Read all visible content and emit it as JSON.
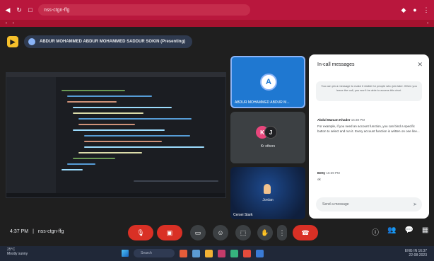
{
  "meeting": {
    "code": "nss-ctgn-ffg",
    "time": "4:37 PM",
    "presenter_pill": "ABDUR MOHAMMED ABDUR MOHAMMED SADDUR SOKIN (Presenting)"
  },
  "participants": [
    {
      "initial": "A",
      "name": "ABDUR MOHAMMED ABDUR M..."
    },
    {
      "initials": [
        "K",
        "J"
      ],
      "label": "Kr others"
    },
    {
      "name": "Cersei Stark",
      "label": "Jordan"
    }
  ],
  "chat": {
    "title": "In-call messages",
    "info": "You can pin a message to make it visible for people who join later. When you leave the call, you won't be able to access this chat.",
    "messages": [
      {
        "sender": "Abdul Manum Khader",
        "time": "16:38 PM",
        "text": "For example, if you need an account function, you can bind a specific button to select and run it. Every account function is written on one line..."
      },
      {
        "sender": "Betty",
        "time": "16:39 PM",
        "text": "ok"
      }
    ],
    "send_placeholder": "Send a message"
  },
  "taskbar": {
    "weather_temp": "25°C",
    "weather_desc": "Mostly sunny",
    "search_placeholder": "Search",
    "lang": "ENG IN",
    "clock_time": "16:37",
    "clock_date": "22-08-2023"
  },
  "colors": {
    "browser_accent": "#b9173d",
    "leave_red": "#d93025",
    "tile_blue": "#1f78d1"
  },
  "icons": {
    "meet_logo": "meet-icon",
    "mic": "mic-off-icon",
    "camera": "camera-off-icon",
    "end_call": "phone-hangup-icon"
  }
}
